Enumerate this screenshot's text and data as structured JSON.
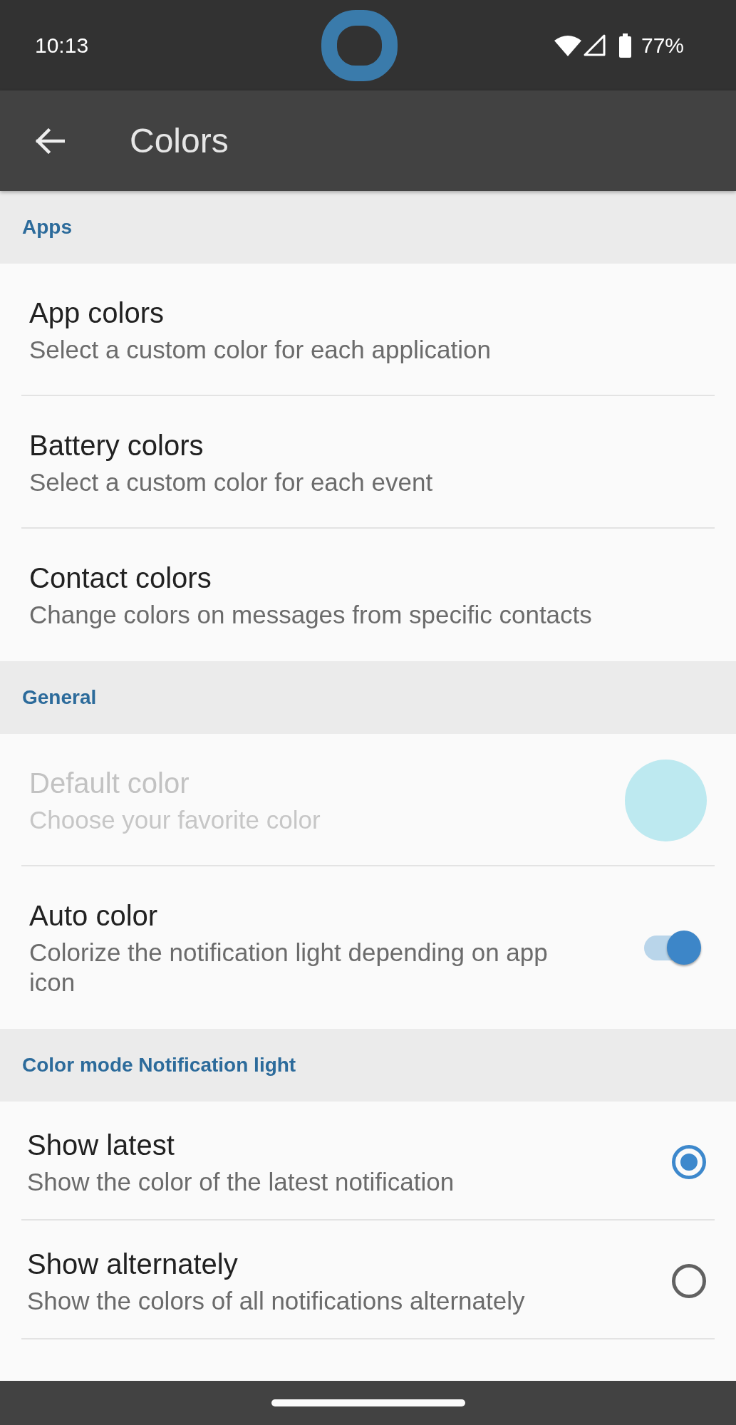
{
  "status_bar": {
    "time": "10:13",
    "battery": "77%"
  },
  "app_bar": {
    "title": "Colors"
  },
  "sections": [
    {
      "header": "Apps",
      "items": [
        {
          "kind": "link",
          "title": "App colors",
          "subtitle": "Select a custom color for each application",
          "disabled": false
        },
        {
          "kind": "link",
          "title": "Battery colors",
          "subtitle": "Select a custom color for each event",
          "disabled": false
        },
        {
          "kind": "link",
          "title": "Contact colors",
          "subtitle": "Change colors on messages from specific contacts",
          "disabled": false
        }
      ]
    },
    {
      "header": "General",
      "items": [
        {
          "kind": "color",
          "title": "Default color",
          "subtitle": "Choose your favorite color",
          "disabled": true,
          "color": "#bde9f0"
        },
        {
          "kind": "switch",
          "title": "Auto color",
          "subtitle": "Colorize the notification light depending on app icon",
          "disabled": false,
          "on": true
        }
      ]
    },
    {
      "header": "Color mode Notification light",
      "items": [
        {
          "kind": "radio",
          "title": "Show latest",
          "subtitle": "Show the color of the latest notification",
          "disabled": false,
          "selected": true
        },
        {
          "kind": "radio",
          "title": "Show alternately",
          "subtitle": "Show the colors of all notifications alternately",
          "disabled": false,
          "selected": false
        }
      ]
    }
  ]
}
